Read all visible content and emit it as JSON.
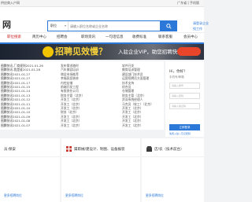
{
  "topbar": {
    "left_text": "供应商入户网",
    "right_text": "广东省 | 手机版"
  },
  "header": {
    "logo": "网",
    "search_category": "职位",
    "search_placeholder": "请输入职位名称或企业名称",
    "side_links": [
      "请登录企业",
      "找工作"
    ]
  },
  "nav": {
    "items": [
      "职位搜索",
      "简历中心",
      "招聘会",
      "职场资讯",
      "一句话信息",
      "收费标准",
      "联系客服",
      "会员中心"
    ],
    "active_index": 0
  },
  "banner": {
    "headline": "招聘见效慢？",
    "subline": "入驻企业VIP，助您招聘快人一步"
  },
  "list": {
    "col1": [
      "图腾快讯-厂商规则2021-01-26",
      "图腾快讯-我是谁2021-01-28",
      "图腾快讯2021-01-27",
      "图腾快讯2021-01-27",
      "图腾快讯2021-01-17",
      "图腾快讯2021-01-15",
      "图腾快讯2021-01-14",
      "图腾快讯2021-01-13",
      "图腾快讯2021-01-12",
      "图腾快讯2021-01-11",
      "图腾快讯2021-01-10",
      "图腾快讯2021-01-10",
      "图腾快讯2021-01-09",
      "图腾快讯2021-01-08",
      "图腾快讯2021-01-07"
    ],
    "col2": [
      "发布需求随时",
      "汽车美容培训",
      "增设市场推荐",
      "幸福家居装修",
      "内控店铺",
      "前端开发工程",
      "有限责任公司",
      "财务主管（北京）",
      "开发工（北京）",
      "开发工（北京）",
      "开发工（北京）",
      "财务（北京）",
      "开发工（北京）",
      "开发工（北京）",
      "开发工（北京）"
    ],
    "col3": [
      "软件开发",
      "教育培训管理",
      "建设部门技术员",
      "运营招聘员方面管理",
      "技术支持",
      "综合员",
      "仓储管理",
      "财务主管（北京）",
      "资深系统经理人",
      "马克员（软工）（北京）",
      "开发工（北京）",
      "开发工（北京）",
      "开发工（北京）",
      "开发工（北京）",
      "开发工（北京）"
    ]
  },
  "login": {
    "greeting": "Hi，你好！",
    "account_label": "手机号/邮箱",
    "fields": [
      "请输入账号",
      "请输入密码",
      "请输入验证码"
    ],
    "button": "立即登录",
    "footer": "免费入驻 | 忘记密码"
  },
  "cards": [
    {
      "title": "员·保安",
      "link": "更多招聘岗位"
    },
    {
      "title": "属职械/建设计、制图、设备报装",
      "link": "更多招聘岗位"
    },
    {
      "title": "店/农（技术前台）",
      "link": "更多招聘岗位"
    }
  ],
  "colors": {
    "accent": "#2b78d8",
    "nav_active": "#cc2222",
    "banner_yellow": "#f6d03a",
    "banner_button": "#e8452a"
  }
}
